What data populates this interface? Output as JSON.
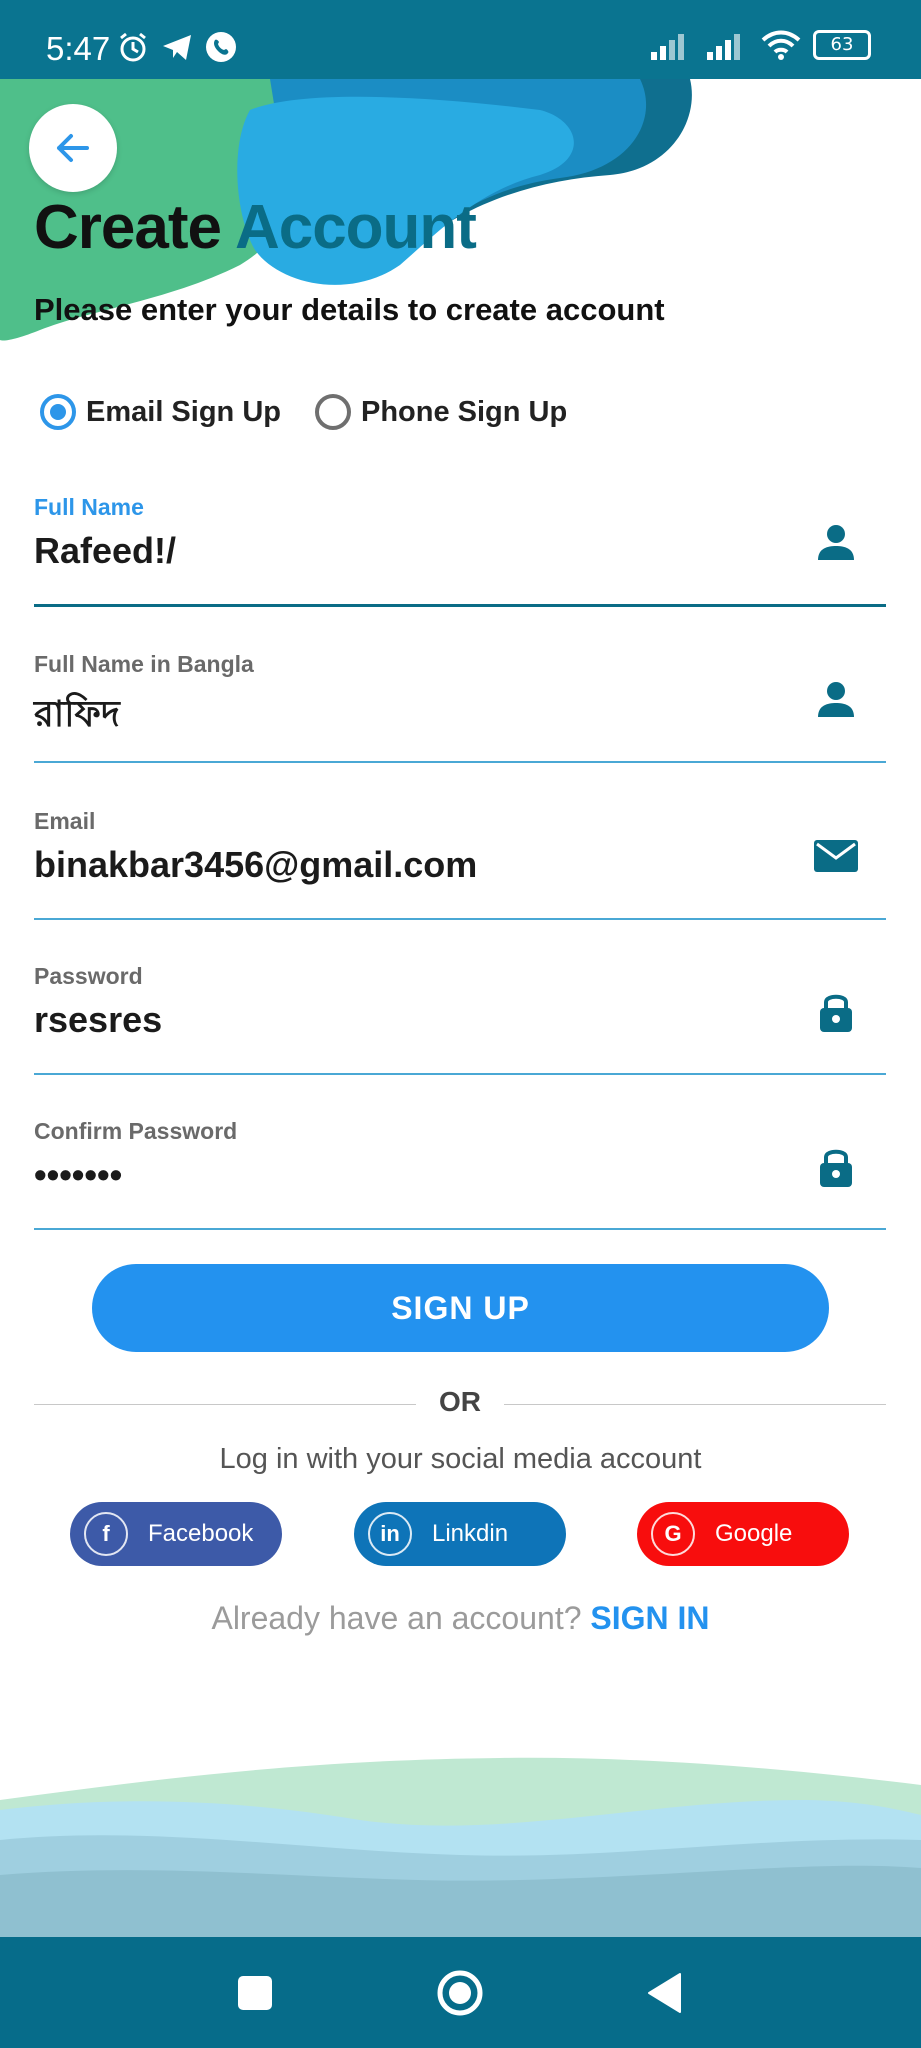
{
  "status_bar": {
    "time": "5:47",
    "left_icons": [
      "alarm-icon",
      "telegram-icon",
      "phone-call-icon"
    ],
    "right_icons": [
      "signal-icon",
      "signal-icon",
      "wifi-icon"
    ],
    "battery": "63"
  },
  "header": {
    "back_icon": "arrow-left-icon",
    "title_part1": "Create",
    "title_part2": "Account",
    "subtitle": "Please enter your details to create account"
  },
  "signup_mode": {
    "options": [
      {
        "label": "Email Sign Up",
        "selected": true
      },
      {
        "label": "Phone Sign Up",
        "selected": false
      }
    ]
  },
  "form": {
    "fields": [
      {
        "label": "Full Name",
        "value": "Rafeed!/",
        "icon": "person-icon",
        "focused": true
      },
      {
        "label": "Full Name in Bangla",
        "value": "রাফিদ",
        "icon": "person-icon",
        "focused": false
      },
      {
        "label": "Email",
        "value": "binakbar3456@gmail.com",
        "icon": "mail-icon",
        "focused": false
      },
      {
        "label": "Password",
        "value": "rsesres",
        "icon": "lock-icon",
        "focused": false
      },
      {
        "label": "Confirm Password",
        "value": "•••••••",
        "icon": "lock-icon",
        "focused": false
      }
    ],
    "submit_label": "SIGN UP"
  },
  "divider": {
    "label": "OR"
  },
  "social": {
    "hint": "Log in with your social media account",
    "buttons": [
      {
        "label": "Facebook",
        "icon": "facebook-icon",
        "glyph": "f",
        "color": "#3d5aa8"
      },
      {
        "label": "Linkdin",
        "icon": "linkedin-icon",
        "glyph": "in",
        "color": "#0e74b8"
      },
      {
        "label": "Google",
        "icon": "google-icon",
        "glyph": "G",
        "color": "#f80d0d"
      }
    ]
  },
  "signin": {
    "question": "Already have an account?",
    "link": "SIGN IN"
  },
  "nav_bar": {
    "icons": [
      "recents-square-icon",
      "home-circle-icon",
      "back-triangle-icon"
    ]
  },
  "colors": {
    "primary": "#2392ef",
    "dark_teal": "#0a6c86",
    "accent_blue": "#2d96e9"
  }
}
